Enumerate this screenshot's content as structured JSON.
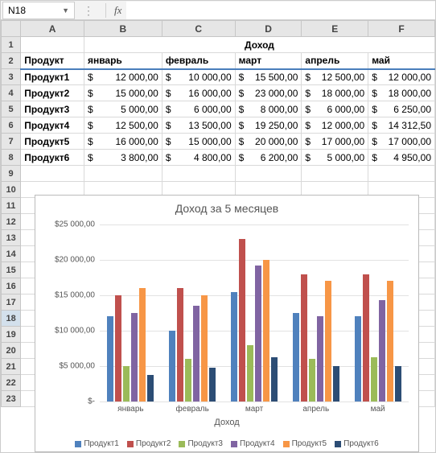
{
  "name_box": "N18",
  "formula_bar": "",
  "columns": [
    "A",
    "B",
    "C",
    "D",
    "E",
    "F"
  ],
  "row_labels": [
    "1",
    "2",
    "3",
    "4",
    "5",
    "6",
    "7",
    "8",
    "9",
    "10",
    "11",
    "12",
    "13",
    "14",
    "15",
    "16",
    "17",
    "18",
    "19",
    "20",
    "21",
    "22",
    "23"
  ],
  "selected_row": "18",
  "title_cell": "Доход",
  "header_row": {
    "product": "Продукт",
    "months": [
      "январь",
      "февраль",
      "март",
      "апрель",
      "май"
    ]
  },
  "products": [
    {
      "name": "Продукт1",
      "values": [
        "12 000,00",
        "10 000,00",
        "15 500,00",
        "12 500,00",
        "12 000,00"
      ]
    },
    {
      "name": "Продукт2",
      "values": [
        "15 000,00",
        "16 000,00",
        "23 000,00",
        "18 000,00",
        "18 000,00"
      ]
    },
    {
      "name": "Продукт3",
      "values": [
        "5 000,00",
        "6 000,00",
        "8 000,00",
        "6 000,00",
        "6 250,00"
      ]
    },
    {
      "name": "Продукт4",
      "values": [
        "12 500,00",
        "13 500,00",
        "19 250,00",
        "12 000,00",
        "14 312,50"
      ]
    },
    {
      "name": "Продукт5",
      "values": [
        "16 000,00",
        "15 000,00",
        "20 000,00",
        "17 000,00",
        "17 000,00"
      ]
    },
    {
      "name": "Продукт6",
      "values": [
        "3 800,00",
        "4 800,00",
        "6 200,00",
        "5 000,00",
        "4 950,00"
      ]
    }
  ],
  "currency": "$",
  "chart_data": {
    "type": "bar",
    "title": "Доход за 5 месяцев",
    "xlabel": "Доход",
    "ylabel": "",
    "ylim": [
      0,
      25000
    ],
    "yticks": [
      "$-",
      "$5 000,00",
      "$10 000,00",
      "$15 000,00",
      "$20 000,00",
      "$25 000,00"
    ],
    "categories": [
      "январь",
      "февраль",
      "март",
      "апрель",
      "май"
    ],
    "series": [
      {
        "name": "Продукт1",
        "values": [
          12000,
          10000,
          15500,
          12500,
          12000
        ]
      },
      {
        "name": "Продукт2",
        "values": [
          15000,
          16000,
          23000,
          18000,
          18000
        ]
      },
      {
        "name": "Продукт3",
        "values": [
          5000,
          6000,
          8000,
          6000,
          6250
        ]
      },
      {
        "name": "Продукт4",
        "values": [
          12500,
          13500,
          19250,
          12000,
          14312.5
        ]
      },
      {
        "name": "Продукт5",
        "values": [
          16000,
          15000,
          20000,
          17000,
          17000
        ]
      },
      {
        "name": "Продукт6",
        "values": [
          3800,
          4800,
          6200,
          5000,
          4950
        ]
      }
    ],
    "colors": [
      "#4f81bd",
      "#c0504d",
      "#9bbb59",
      "#8064a2",
      "#f79646",
      "#2c4d75"
    ]
  }
}
